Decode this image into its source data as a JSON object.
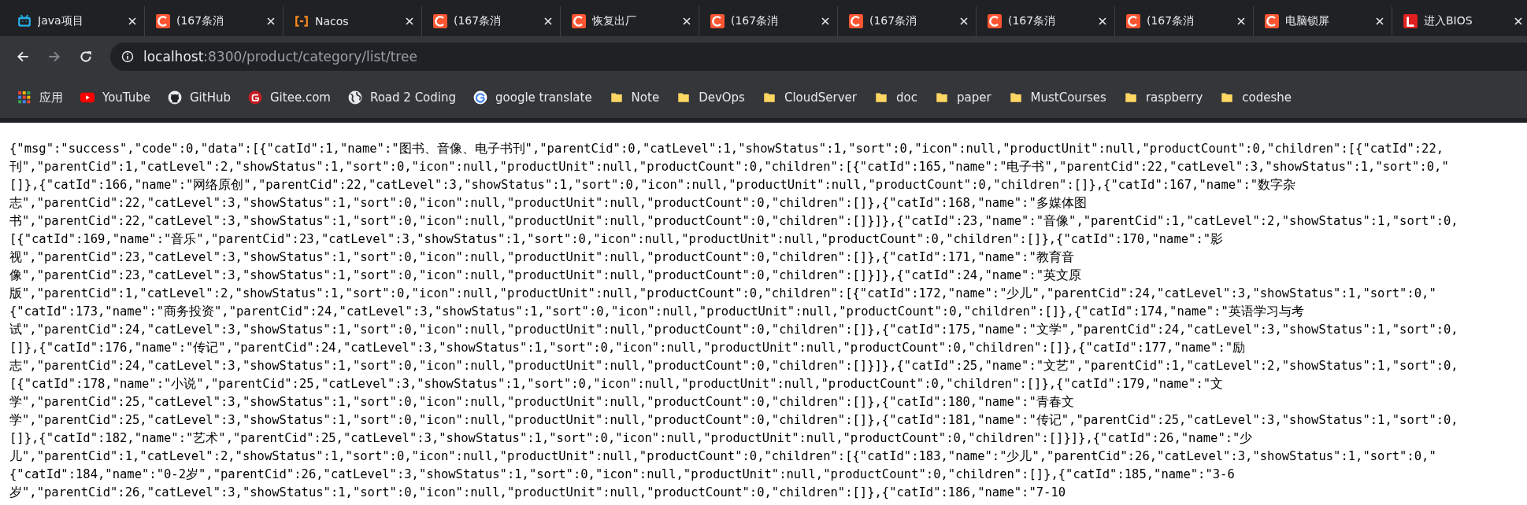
{
  "tabs": [
    {
      "title": "Java项目",
      "kind": "tv"
    },
    {
      "title": "(167条消",
      "kind": "c-logo"
    },
    {
      "title": "Nacos",
      "kind": "bracket"
    },
    {
      "title": "(167条消",
      "kind": "c-logo"
    },
    {
      "title": "恢复出厂",
      "kind": "c-logo"
    },
    {
      "title": "(167条消",
      "kind": "c-logo"
    },
    {
      "title": "(167条消",
      "kind": "c-logo"
    },
    {
      "title": "(167条消",
      "kind": "c-logo"
    },
    {
      "title": "(167条消",
      "kind": "c-logo"
    },
    {
      "title": "电脑锁屏",
      "kind": "c-logo"
    },
    {
      "title": "进入BIOS",
      "kind": "l-logo"
    }
  ],
  "address": {
    "host": "localhost",
    "path": ":8300/product/category/list/tree"
  },
  "bookmarks": [
    {
      "label": "应用",
      "kind": "apps"
    },
    {
      "label": "YouTube",
      "kind": "youtube"
    },
    {
      "label": "GitHub",
      "kind": "github"
    },
    {
      "label": "Gitee.com",
      "kind": "gitee"
    },
    {
      "label": "Road 2 Coding",
      "kind": "globe"
    },
    {
      "label": "google translate",
      "kind": "google"
    },
    {
      "label": "Note",
      "kind": "folder"
    },
    {
      "label": "DevOps",
      "kind": "folder"
    },
    {
      "label": "CloudServer",
      "kind": "folder"
    },
    {
      "label": "doc",
      "kind": "folder"
    },
    {
      "label": "paper",
      "kind": "folder"
    },
    {
      "label": "MustCourses",
      "kind": "folder"
    },
    {
      "label": "raspberry",
      "kind": "folder"
    },
    {
      "label": "codeshe",
      "kind": "folder"
    }
  ],
  "body_lines": [
    "{\"msg\":\"success\",\"code\":0,\"data\":[{\"catId\":1,\"name\":\"图书、音像、电子书刊\",\"parentCid\":0,\"catLevel\":1,\"showStatus\":1,\"sort\":0,\"icon\":null,\"productUnit\":null,\"productCount\":0,\"children\":[{\"catId\":22,",
    "刊\",\"parentCid\":1,\"catLevel\":2,\"showStatus\":1,\"sort\":0,\"icon\":null,\"productUnit\":null,\"productCount\":0,\"children\":[{\"catId\":165,\"name\":\"电子书\",\"parentCid\":22,\"catLevel\":3,\"showStatus\":1,\"sort\":0,\"",
    "[]},{\"catId\":166,\"name\":\"网络原创\",\"parentCid\":22,\"catLevel\":3,\"showStatus\":1,\"sort\":0,\"icon\":null,\"productUnit\":null,\"productCount\":0,\"children\":[]},{\"catId\":167,\"name\":\"数字杂",
    "志\",\"parentCid\":22,\"catLevel\":3,\"showStatus\":1,\"sort\":0,\"icon\":null,\"productUnit\":null,\"productCount\":0,\"children\":[]},{\"catId\":168,\"name\":\"多媒体图",
    "书\",\"parentCid\":22,\"catLevel\":3,\"showStatus\":1,\"sort\":0,\"icon\":null,\"productUnit\":null,\"productCount\":0,\"children\":[]}]},{\"catId\":23,\"name\":\"音像\",\"parentCid\":1,\"catLevel\":2,\"showStatus\":1,\"sort\":0,",
    "[{\"catId\":169,\"name\":\"音乐\",\"parentCid\":23,\"catLevel\":3,\"showStatus\":1,\"sort\":0,\"icon\":null,\"productUnit\":null,\"productCount\":0,\"children\":[]},{\"catId\":170,\"name\":\"影",
    "视\",\"parentCid\":23,\"catLevel\":3,\"showStatus\":1,\"sort\":0,\"icon\":null,\"productUnit\":null,\"productCount\":0,\"children\":[]},{\"catId\":171,\"name\":\"教育音",
    "像\",\"parentCid\":23,\"catLevel\":3,\"showStatus\":1,\"sort\":0,\"icon\":null,\"productUnit\":null,\"productCount\":0,\"children\":[]}]},{\"catId\":24,\"name\":\"英文原",
    "版\",\"parentCid\":1,\"catLevel\":2,\"showStatus\":1,\"sort\":0,\"icon\":null,\"productUnit\":null,\"productCount\":0,\"children\":[{\"catId\":172,\"name\":\"少儿\",\"parentCid\":24,\"catLevel\":3,\"showStatus\":1,\"sort\":0,\"",
    "{\"catId\":173,\"name\":\"商务投资\",\"parentCid\":24,\"catLevel\":3,\"showStatus\":1,\"sort\":0,\"icon\":null,\"productUnit\":null,\"productCount\":0,\"children\":[]},{\"catId\":174,\"name\":\"英语学习与考",
    "试\",\"parentCid\":24,\"catLevel\":3,\"showStatus\":1,\"sort\":0,\"icon\":null,\"productUnit\":null,\"productCount\":0,\"children\":[]},{\"catId\":175,\"name\":\"文学\",\"parentCid\":24,\"catLevel\":3,\"showStatus\":1,\"sort\":0,",
    "[]},{\"catId\":176,\"name\":\"传记\",\"parentCid\":24,\"catLevel\":3,\"showStatus\":1,\"sort\":0,\"icon\":null,\"productUnit\":null,\"productCount\":0,\"children\":[]},{\"catId\":177,\"name\":\"励",
    "志\",\"parentCid\":24,\"catLevel\":3,\"showStatus\":1,\"sort\":0,\"icon\":null,\"productUnit\":null,\"productCount\":0,\"children\":[]}]},{\"catId\":25,\"name\":\"文艺\",\"parentCid\":1,\"catLevel\":2,\"showStatus\":1,\"sort\":0,",
    "[{\"catId\":178,\"name\":\"小说\",\"parentCid\":25,\"catLevel\":3,\"showStatus\":1,\"sort\":0,\"icon\":null,\"productUnit\":null,\"productCount\":0,\"children\":[]},{\"catId\":179,\"name\":\"文",
    "学\",\"parentCid\":25,\"catLevel\":3,\"showStatus\":1,\"sort\":0,\"icon\":null,\"productUnit\":null,\"productCount\":0,\"children\":[]},{\"catId\":180,\"name\":\"青春文",
    "学\",\"parentCid\":25,\"catLevel\":3,\"showStatus\":1,\"sort\":0,\"icon\":null,\"productUnit\":null,\"productCount\":0,\"children\":[]},{\"catId\":181,\"name\":\"传记\",\"parentCid\":25,\"catLevel\":3,\"showStatus\":1,\"sort\":0,",
    "[]},{\"catId\":182,\"name\":\"艺术\",\"parentCid\":25,\"catLevel\":3,\"showStatus\":1,\"sort\":0,\"icon\":null,\"productUnit\":null,\"productCount\":0,\"children\":[]}]},{\"catId\":26,\"name\":\"少",
    "儿\",\"parentCid\":1,\"catLevel\":2,\"showStatus\":1,\"sort\":0,\"icon\":null,\"productUnit\":null,\"productCount\":0,\"children\":[{\"catId\":183,\"name\":\"少儿\",\"parentCid\":26,\"catLevel\":3,\"showStatus\":1,\"sort\":0,\"",
    "{\"catId\":184,\"name\":\"0-2岁\",\"parentCid\":26,\"catLevel\":3,\"showStatus\":1,\"sort\":0,\"icon\":null,\"productUnit\":null,\"productCount\":0,\"children\":[]},{\"catId\":185,\"name\":\"3-6",
    "岁\",\"parentCid\":26,\"catLevel\":3,\"showStatus\":1,\"sort\":0,\"icon\":null,\"productUnit\":null,\"productCount\":0,\"children\":[]},{\"catId\":186,\"name\":\"7-10"
  ]
}
